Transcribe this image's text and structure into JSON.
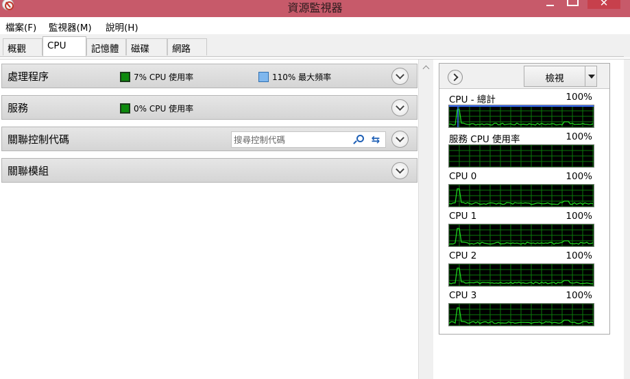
{
  "window": {
    "title": "資源監視器"
  },
  "menu": [
    "檔案(F)",
    "監視器(M)",
    "說明(H)"
  ],
  "tabs": [
    "概觀",
    "CPU",
    "記憶體",
    "磁碟",
    "網路"
  ],
  "active_tab": "CPU",
  "sections": {
    "processes": {
      "title": "處理程序",
      "cpu_usage": "7% CPU 使用率",
      "max_freq": "110% 最大頻率"
    },
    "services": {
      "title": "服務",
      "cpu_usage": "0% CPU 使用率"
    },
    "handles": {
      "title": "關聯控制代碼",
      "search_placeholder": "搜尋控制代碼"
    },
    "modules": {
      "title": "關聯模組"
    }
  },
  "graph_panel": {
    "view_button": "檢視",
    "graphs": [
      {
        "label": "CPU - 總計",
        "percent": "100%"
      },
      {
        "label": "服務 CPU 使用率",
        "percent": "100%"
      },
      {
        "label": "CPU 0",
        "percent": "100%"
      },
      {
        "label": "CPU 1",
        "percent": "100%"
      },
      {
        "label": "CPU 2",
        "percent": "100%"
      },
      {
        "label": "CPU 3",
        "percent": "100%"
      }
    ]
  },
  "colors": {
    "titlebar": "#c75a6a",
    "graph_background": "#000000",
    "graph_grid": "#0b7a0b",
    "graph_line": "#20e020",
    "graph_accent": "#3a6fff"
  }
}
